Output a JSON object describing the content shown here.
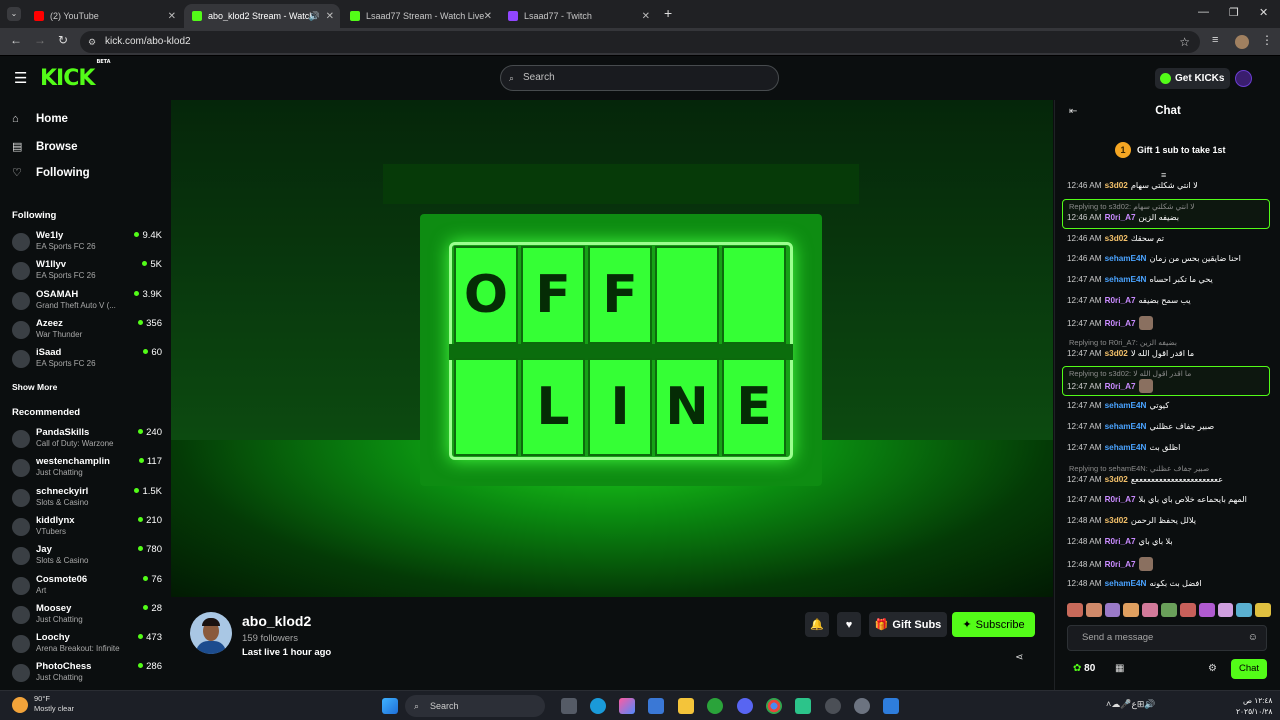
{
  "browser": {
    "tabs": [
      {
        "title": "(2) YouTube",
        "color": "#ff0000"
      },
      {
        "title": "abo_klod2 Stream - Watch",
        "color": "#53fc18"
      },
      {
        "title": "Lsaad77 Stream - Watch Live o",
        "color": "#53fc18"
      },
      {
        "title": "Lsaad77 - Twitch",
        "color": "#9146ff"
      }
    ],
    "url": "kick.com/abo-klod2"
  },
  "header": {
    "logo": "KICK",
    "logo_badge": "BETA",
    "search_placeholder": "Search",
    "get_kicks": "Get KICKs"
  },
  "sidebar": {
    "nav": [
      {
        "label": "Home",
        "icon": "home-icon"
      },
      {
        "label": "Browse",
        "icon": "browse-icon"
      },
      {
        "label": "Following",
        "icon": "heart-icon"
      }
    ],
    "following_title": "Following",
    "following": [
      {
        "name": "We1ly",
        "category": "EA Sports FC 26",
        "viewers": "9.4K"
      },
      {
        "name": "W1llyv",
        "category": "EA Sports FC 26",
        "viewers": "5K"
      },
      {
        "name": "OSAMAH",
        "category": "Grand Theft Auto V (...",
        "viewers": "3.9K"
      },
      {
        "name": "Azeez",
        "category": "War Thunder",
        "viewers": "356"
      },
      {
        "name": "iSaad",
        "category": "EA Sports FC 26",
        "viewers": "60"
      }
    ],
    "show_more": "Show More",
    "recommended_title": "Recommended",
    "recommended": [
      {
        "name": "PandaSkills",
        "category": "Call of Duty: Warzone",
        "viewers": "240"
      },
      {
        "name": "westenchamplin",
        "category": "Just Chatting",
        "viewers": "117"
      },
      {
        "name": "schneckyirl",
        "category": "Slots & Casino",
        "viewers": "1.5K"
      },
      {
        "name": "kiddlynx",
        "category": "VTubers",
        "viewers": "210"
      },
      {
        "name": "Jay",
        "category": "Slots & Casino",
        "viewers": "780"
      },
      {
        "name": "Cosmote06",
        "category": "Art",
        "viewers": "76"
      },
      {
        "name": "Moosey",
        "category": "Just Chatting",
        "viewers": "28"
      },
      {
        "name": "Loochy",
        "category": "Arena Breakout: Infinite",
        "viewers": "473"
      },
      {
        "name": "PhotoChess",
        "category": "Just Chatting",
        "viewers": "286"
      }
    ]
  },
  "player": {
    "top_letters": [
      "O",
      "F",
      "F",
      "",
      ""
    ],
    "bottom_letters": [
      "",
      "L",
      "I",
      "N",
      "E"
    ]
  },
  "channel": {
    "name": "abo_klod2",
    "followers": "159 followers",
    "last_live": "Last live 1 hour ago",
    "gift_subs": "Gift Subs",
    "subscribe": "Subscribe"
  },
  "chat": {
    "title": "Chat",
    "gift_prompt": "Gift 1 sub to take 1st",
    "gift_rank": "1",
    "messages": [
      {
        "type": "msg",
        "ts": "12:46 AM",
        "user": "s3d02",
        "color": "#f5c26b",
        "text": "لا انتي شكلتي سهام"
      },
      {
        "type": "reply",
        "text": "Replying to s3d02: لا انتي شكلتي سهام",
        "hl": true
      },
      {
        "type": "msg",
        "ts": "12:46 AM",
        "user": "R0ri_A7",
        "color": "#c98bff",
        "text": "بضيفه الزين",
        "hl": true
      },
      {
        "type": "msg",
        "ts": "12:46 AM",
        "user": "s3d02",
        "color": "#f5c26b",
        "text": "تم سحقك"
      },
      {
        "type": "msg",
        "ts": "12:46 AM",
        "user": "sehamE4N",
        "color": "#4aa3ff",
        "text": "احنا ضايقين بحس من زمان"
      },
      {
        "type": "msg",
        "ts": "12:47 AM",
        "user": "sehamE4N",
        "color": "#4aa3ff",
        "text": "يحي ما تكبر احساه"
      },
      {
        "type": "msg",
        "ts": "12:47 AM",
        "user": "R0ri_A7",
        "color": "#c98bff",
        "text": "يب سمح بضيفه"
      },
      {
        "type": "msg",
        "ts": "12:47 AM",
        "user": "R0ri_A7",
        "color": "#c98bff",
        "text": ""
      },
      {
        "type": "reply",
        "text": "Replying to R0ri_A7: بضيفه الزين"
      },
      {
        "type": "msg",
        "ts": "12:47 AM",
        "user": "s3d02",
        "color": "#f5c26b",
        "text": "ما اقدر اقول الله لا"
      },
      {
        "type": "reply",
        "text": "Replying to s3d02: ما اقدر اقول الله لا",
        "hl": true
      },
      {
        "type": "msg",
        "ts": "12:47 AM",
        "user": "R0ri_A7",
        "color": "#c98bff",
        "text": "",
        "hl": true
      },
      {
        "type": "msg",
        "ts": "12:47 AM",
        "user": "sehamE4N",
        "color": "#4aa3ff",
        "text": "كيوتي"
      },
      {
        "type": "msg",
        "ts": "12:47 AM",
        "user": "sehamE4N",
        "color": "#4aa3ff",
        "text": "صبير جفاف عظلني"
      },
      {
        "type": "msg",
        "ts": "12:47 AM",
        "user": "sehamE4N",
        "color": "#4aa3ff",
        "text": "اظلق بث"
      },
      {
        "type": "reply",
        "text": "Replying to sehamE4N: صبير جفاف عظلني"
      },
      {
        "type": "msg",
        "ts": "12:47 AM",
        "user": "s3d02",
        "color": "#f5c26b",
        "text": "ععععععععععععععععععععععع"
      },
      {
        "type": "msg",
        "ts": "12:47 AM",
        "user": "R0ri_A7",
        "color": "#c98bff",
        "text": "المهم بايحماعه خلاص باي باي بلا"
      },
      {
        "type": "msg",
        "ts": "12:48 AM",
        "user": "s3d02",
        "color": "#f5c26b",
        "text": "يلالل يحفظ الرحمن"
      },
      {
        "type": "msg",
        "ts": "12:48 AM",
        "user": "R0ri_A7",
        "color": "#c98bff",
        "text": "بلا باي باي"
      },
      {
        "type": "msg",
        "ts": "12:48 AM",
        "user": "R0ri_A7",
        "color": "#c98bff",
        "text": ""
      },
      {
        "type": "msg",
        "ts": "12:48 AM",
        "user": "sehamE4N",
        "color": "#4aa3ff",
        "text": "افضل بث بكونه"
      }
    ],
    "placeholder": "Send a message",
    "points": "80",
    "chat_button": "Chat"
  },
  "taskbar": {
    "temp": "90°F",
    "weather": "Mostly clear",
    "search": "Search",
    "time": "١٢:٤٨ ص",
    "date": "٢٠٢٥/١٠/٢٨"
  }
}
